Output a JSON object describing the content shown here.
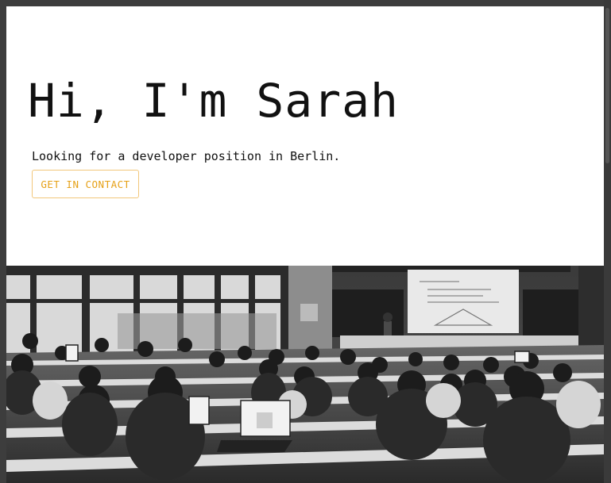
{
  "hero": {
    "title": "Hi, I'm Sarah",
    "subtitle": "Looking for a developer position in Berlin.",
    "button_label": "GET IN CONTACT"
  },
  "photo": {
    "description_icon": "lecture-hall-photo-icon"
  },
  "colors": {
    "background": "#ffffff",
    "text": "#111111",
    "accent": "#e6a118",
    "accent_border": "#f2c77a",
    "frame": "#3d3d3d"
  }
}
